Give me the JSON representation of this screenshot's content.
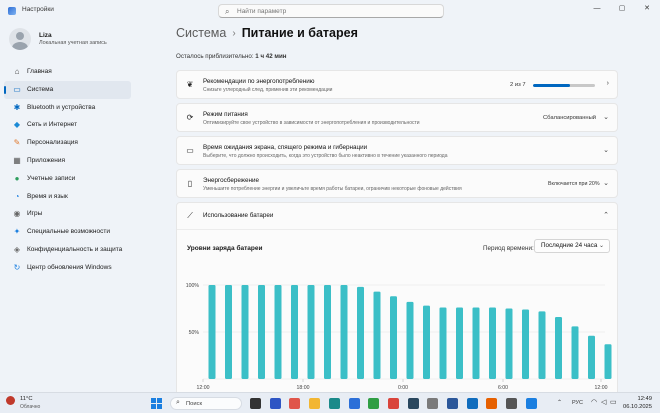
{
  "window": {
    "title": "Настройки",
    "controls": [
      "—",
      "▢",
      "✕"
    ]
  },
  "search": {
    "placeholder": "Найти параметр"
  },
  "user": {
    "name": "Liza",
    "account_type": "Локальная учетная запись"
  },
  "sidebar": {
    "items": [
      {
        "label": "Главная",
        "icon": "home-icon",
        "glyph": "⌂",
        "color": "#444444",
        "active": false
      },
      {
        "label": "Система",
        "icon": "system-icon",
        "glyph": "▭",
        "color": "#0067c0",
        "active": true
      },
      {
        "label": "Bluetooth и устройства",
        "icon": "bluetooth-icon",
        "glyph": "✱",
        "color": "#0067c0",
        "active": false
      },
      {
        "label": "Сеть и Интернет",
        "icon": "network-icon",
        "glyph": "◆",
        "color": "#1b8ad6",
        "active": false
      },
      {
        "label": "Персонализация",
        "icon": "personalization-icon",
        "glyph": "✎",
        "color": "#e07a2f",
        "active": false
      },
      {
        "label": "Приложения",
        "icon": "apps-icon",
        "glyph": "▦",
        "color": "#555555",
        "active": false
      },
      {
        "label": "Учетные записи",
        "icon": "accounts-icon",
        "glyph": "●",
        "color": "#2e9e5e",
        "active": false
      },
      {
        "label": "Время и язык",
        "icon": "time-language-icon",
        "glyph": "◔",
        "color": "#1b7fe0",
        "active": false
      },
      {
        "label": "Игры",
        "icon": "gaming-icon",
        "glyph": "◉",
        "color": "#666666",
        "active": false
      },
      {
        "label": "Специальные возможности",
        "icon": "accessibility-icon",
        "glyph": "✦",
        "color": "#1b7fe0",
        "active": false
      },
      {
        "label": "Конфиденциальность и защита",
        "icon": "privacy-shield-icon",
        "glyph": "◈",
        "color": "#6b6b6b",
        "active": false
      },
      {
        "label": "Центр обновления Windows",
        "icon": "windows-update-icon",
        "glyph": "↻",
        "color": "#1b7fe0",
        "active": false
      }
    ]
  },
  "breadcrumb": {
    "parent": "Система",
    "separator": "›",
    "current": "Питание и батарея"
  },
  "battery": {
    "remaining_label": "Осталось приблизительно:",
    "remaining_value": "1 ч 42 мин"
  },
  "cards": {
    "recommendations": {
      "title": "Рекомендации по энергопотреблению",
      "subtitle": "Снизьте углеродный след, применив эти рекомендации",
      "count": "2 из 7",
      "progress": 0.6,
      "chevron": "›",
      "icon": "leaf-icon"
    },
    "power_mode": {
      "title": "Режим питания",
      "subtitle": "Оптимизируйте свое устройство в зависимости от энергопотребления и производительности",
      "value": "Сбалансированный",
      "chevron": "⌄",
      "icon": "power-mode-icon"
    },
    "screen_timeout": {
      "title": "Время ожидания экрана, спящего режима и гибернации",
      "subtitle": "Выберите, что должно происходить, когда это устройство было неактивно в течение указанного периода",
      "chevron": "⌄",
      "icon": "screen-sleep-icon"
    },
    "energy_saver": {
      "title": "Энергосбережение",
      "subtitle": "Уменьшите потребление энергии и увеличьте время работы батареи, ограничив некоторые фоновые действия",
      "value": "Включается при 20%",
      "chevron": "⌄",
      "icon": "battery-saver-icon"
    },
    "battery_usage": {
      "title": "Использование батареи",
      "chevron": "⌃",
      "icon": "battery-usage-icon",
      "chart_title": "Уровни заряда батареи",
      "period_label": "Период времени:",
      "period_value": "Последние 24 часа",
      "period_chevron": "⌄"
    }
  },
  "chart_data": {
    "type": "bar",
    "title": "Уровни заряда батареи",
    "y_tick_labels": [
      "100%",
      "50%"
    ],
    "ylim": [
      0,
      100
    ],
    "x_tick_labels": [
      "12:00",
      "18:00",
      "0:00",
      "6:00",
      "12:00"
    ],
    "values": [
      100,
      100,
      100,
      100,
      100,
      100,
      100,
      100,
      100,
      98,
      93,
      88,
      82,
      78,
      76,
      76,
      76,
      76,
      75,
      74,
      72,
      66,
      56,
      46,
      37,
      35
    ],
    "bar_color": "#3bbfc7",
    "grid": true
  },
  "taskbar": {
    "weather_temp": "11°C",
    "weather_cond": "Облачно",
    "search_label": "Поиск",
    "apps": [
      {
        "icon": "task-view-icon",
        "color": "#333333"
      },
      {
        "icon": "game-icon",
        "color": "#2e55c4"
      },
      {
        "icon": "photos-icon",
        "color": "#e0564b"
      },
      {
        "icon": "file-explorer-icon",
        "color": "#f2b632"
      },
      {
        "icon": "edge-browser-icon",
        "color": "#1b8a8a"
      },
      {
        "icon": "store-icon",
        "color": "#2b6fd8"
      },
      {
        "icon": "xbox-icon",
        "color": "#2f9e44"
      },
      {
        "icon": "chrome-icon",
        "color": "#d9443b"
      },
      {
        "icon": "steam-icon",
        "color": "#2a475e"
      },
      {
        "icon": "app-icon",
        "color": "#7a7a7a"
      },
      {
        "icon": "word-icon",
        "color": "#2b579a"
      },
      {
        "icon": "outlook-icon",
        "color": "#0f6cbd"
      },
      {
        "icon": "firefox-icon",
        "color": "#e66000"
      },
      {
        "icon": "settings-gear-icon",
        "color": "#555555"
      },
      {
        "icon": "security-icon",
        "color": "#1b7fe0"
      }
    ],
    "tray_arrow": "⌃",
    "lang": "РУС",
    "time": "12:49",
    "date": "06.10.2025"
  }
}
